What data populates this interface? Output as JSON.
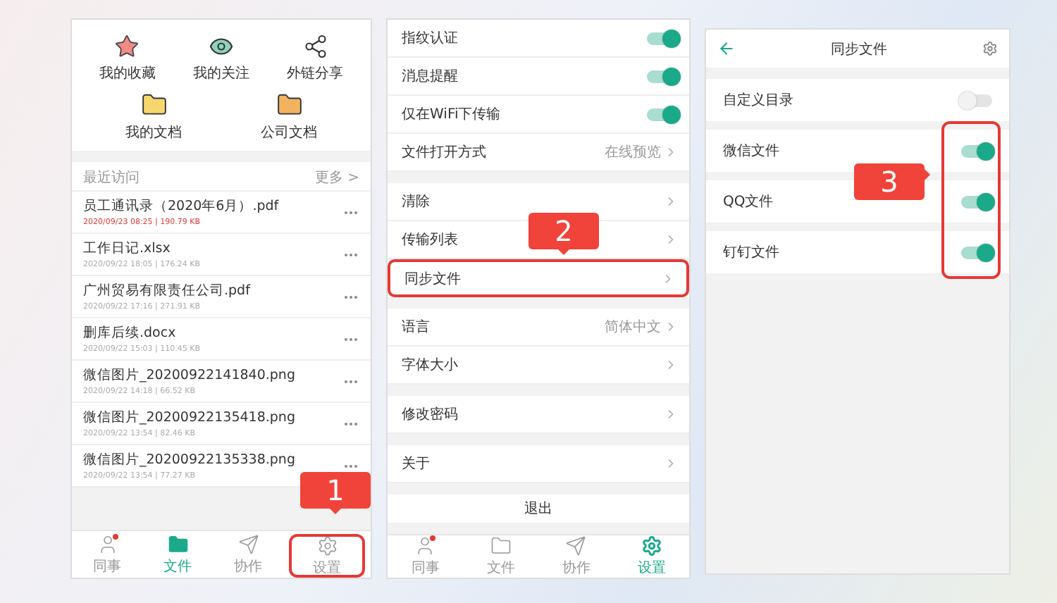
{
  "files_screen": {
    "shortcuts": [
      {
        "label": "我的收藏"
      },
      {
        "label": "我的关注"
      },
      {
        "label": "外链分享"
      }
    ],
    "folders": [
      {
        "label": "我的文档",
        "color": "#f5d76e"
      },
      {
        "label": "公司文档",
        "color": "#f3b25f"
      }
    ],
    "recent": {
      "title": "最近访问",
      "more": "更多 >"
    },
    "files": [
      {
        "name": "员工通讯录（2020年6月）.pdf",
        "meta": "2020/09/23 08:25 | 190.79 KB",
        "highlighted": true
      },
      {
        "name": "工作日记.xlsx",
        "meta": "2020/09/22 18:05 | 176.24 KB",
        "highlighted": false
      },
      {
        "name": "广州贸易有限责任公司.pdf",
        "meta": "2020/09/22 17:16 | 271.91 KB",
        "highlighted": false
      },
      {
        "name": "删库后续.docx",
        "meta": "2020/09/22 15:03 | 110.45 KB",
        "highlighted": false
      },
      {
        "name": "微信图片_20200922141840.png",
        "meta": "2020/09/22 14:18 | 66.52 KB",
        "highlighted": false
      },
      {
        "name": "微信图片_20200922135418.png",
        "meta": "2020/09/22 13:54 | 82.46 KB",
        "highlighted": false
      },
      {
        "name": "微信图片_20200922135338.png",
        "meta": "2020/09/22 13:54 | 77.27 KB",
        "highlighted": false
      }
    ],
    "tab_bar": [
      {
        "label": "同事",
        "selected": false,
        "badge": true,
        "outlined": false
      },
      {
        "label": "文件",
        "selected": true,
        "badge": false,
        "outlined": false
      },
      {
        "label": "协作",
        "selected": false,
        "badge": false,
        "outlined": false
      },
      {
        "label": "设置",
        "selected": false,
        "badge": false,
        "outlined": true
      }
    ],
    "callout": "1"
  },
  "settings_screen": {
    "groups": [
      [
        {
          "kind": "toggle",
          "label": "指纹认证",
          "on": true
        },
        {
          "kind": "toggle",
          "label": "消息提醒",
          "on": true
        },
        {
          "kind": "toggle",
          "label": "仅在WiFi下传输",
          "on": true
        },
        {
          "kind": "link",
          "label": "文件打开方式",
          "value": "在线预览",
          "outlined": false
        }
      ],
      [
        {
          "kind": "link",
          "label": "清除",
          "outlined": false
        },
        {
          "kind": "link",
          "label": "传输列表",
          "outlined": false
        },
        {
          "kind": "link",
          "label": "同步文件",
          "outlined": true
        }
      ],
      [
        {
          "kind": "link",
          "label": "语言",
          "value": "简体中文",
          "outlined": false
        },
        {
          "kind": "link",
          "label": "字体大小",
          "outlined": false
        }
      ],
      [
        {
          "kind": "link",
          "label": "修改密码",
          "outlined": false
        }
      ],
      [
        {
          "kind": "link",
          "label": "关于",
          "outlined": false
        }
      ]
    ],
    "logout": "退出",
    "tab_bar": [
      {
        "label": "同事",
        "selected": false,
        "badge": true,
        "outlined": false
      },
      {
        "label": "文件",
        "selected": false,
        "badge": false,
        "outlined": false
      },
      {
        "label": "协作",
        "selected": false,
        "badge": false,
        "outlined": false
      },
      {
        "label": "设置",
        "selected": true,
        "badge": false,
        "outlined": false
      }
    ],
    "callout": "2"
  },
  "sync_screen": {
    "title": "同步文件",
    "rows": [
      {
        "label": "自定义目录",
        "on": false
      },
      {
        "label": "微信文件",
        "on": true
      },
      {
        "label": "QQ文件",
        "on": true
      },
      {
        "label": "钉钉文件",
        "on": true
      }
    ],
    "callout": "3"
  }
}
